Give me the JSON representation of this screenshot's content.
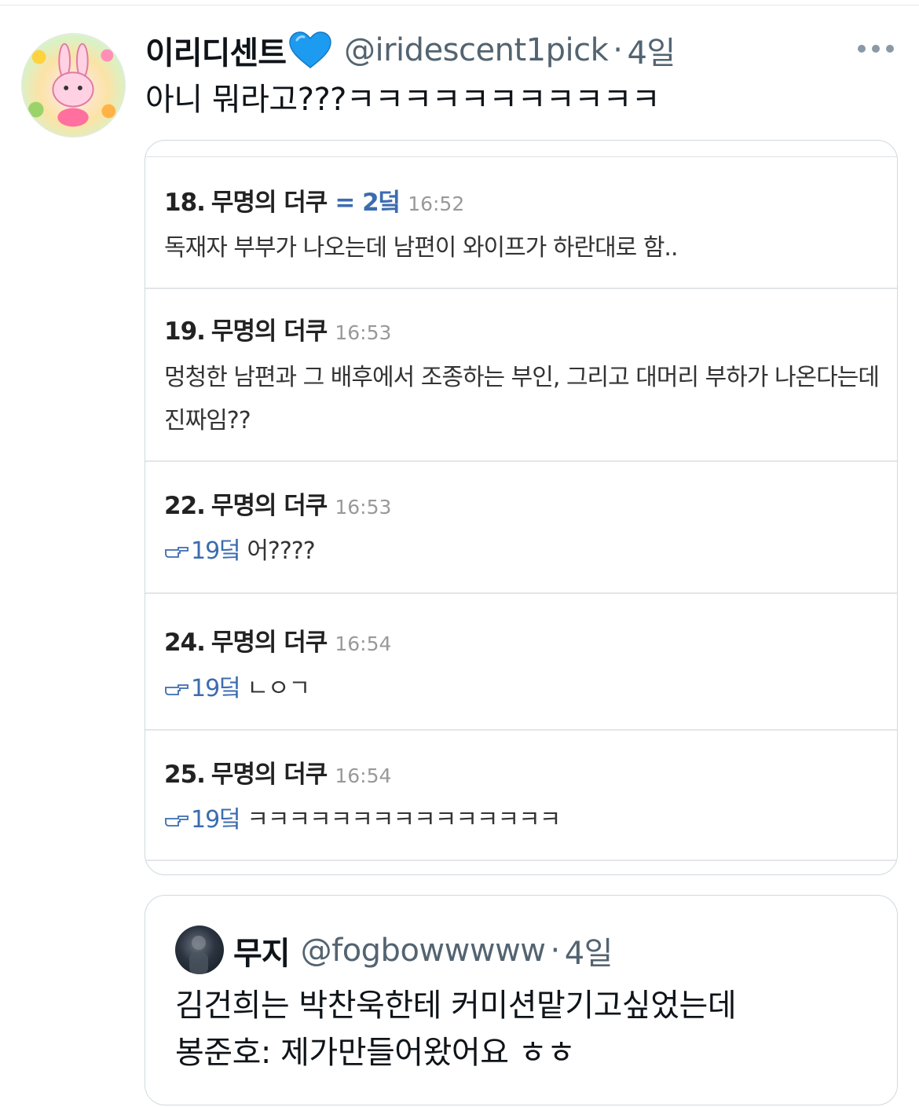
{
  "tweet": {
    "display_name": "이리디센트",
    "handle": "@iridescent1pick",
    "separator": "·",
    "age": "4일",
    "text": "아니 뭐라고???ㅋㅋㅋㅋㅋㅋㅋㅋㅋㅋㅋ"
  },
  "media": {
    "posts": [
      {
        "number": "18.",
        "author": "무명의 더쿠",
        "tag": "= 2덬",
        "time": "16:52",
        "reply_to": "",
        "body": "독재자 부부가 나오는데 남편이 와이프가 하란대로 함.."
      },
      {
        "number": "19.",
        "author": "무명의 더쿠",
        "tag": "",
        "time": "16:53",
        "reply_to": "",
        "body": "멍청한 남편과 그 배후에서 조종하는 부인, 그리고 대머리 부하가 나온다는데 진짜임??"
      },
      {
        "number": "22.",
        "author": "무명의 더쿠",
        "tag": "",
        "time": "16:53",
        "reply_to": "19덬",
        "body": "어????"
      },
      {
        "number": "24.",
        "author": "무명의 더쿠",
        "tag": "",
        "time": "16:54",
        "reply_to": "19덬",
        "body": "ㄴㅇㄱ"
      },
      {
        "number": "25.",
        "author": "무명의 더쿠",
        "tag": "",
        "time": "16:54",
        "reply_to": "19덬",
        "body": "ㅋㅋㅋㅋㅋㅋㅋㅋㅋㅋㅋㅋㅋㅋㅋ"
      }
    ]
  },
  "quote": {
    "display_name": "무지",
    "handle": "@fogbowwwww",
    "separator": "·",
    "age": "4일",
    "text_line1": "김건희는 박찬욱한테 커미션맡기고싶었는데",
    "text_line2": "봉준호: 제가만들어왔어요 ㅎㅎ"
  },
  "colors": {
    "verified_heart": "#1d9bf0",
    "reply_link": "#3c6cb0",
    "secondary_text": "#536471"
  },
  "icons": {
    "heart": "blue-heart-icon",
    "more": "more-dots-icon",
    "reply_pointer": "pointing-hand-icon"
  }
}
